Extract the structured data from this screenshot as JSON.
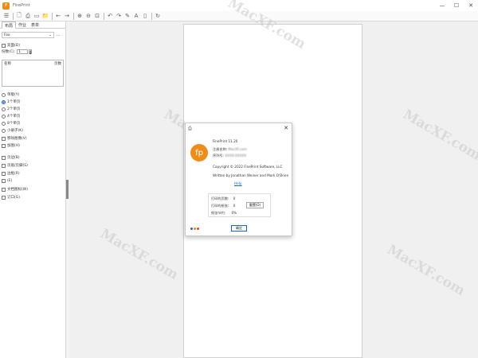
{
  "window": {
    "title": "FinePrint",
    "minimize": "—",
    "maximize": "☐",
    "close": "✕"
  },
  "toolbar": {
    "buttons": [
      "☰",
      "🗋",
      "⎙",
      "▭",
      "📁",
      "←",
      "→",
      "⊕",
      "⊖",
      "⊡",
      "↶",
      "↷",
      "✎",
      "A",
      "▯",
      "↻"
    ]
  },
  "left": {
    "tabs": [
      "布局",
      "作业",
      "表单"
    ],
    "printer": "Fax",
    "more": "...",
    "duplex": "双面(D)",
    "copies_label": "份数(C):",
    "copies_value": "1",
    "list_headers": [
      "名称",
      "页数"
    ],
    "layout_options": [
      {
        "label": "单版(Y)",
        "checked": false
      },
      {
        "label": "1个单页",
        "checked": true
      },
      {
        "label": "2个单页",
        "checked": false
      },
      {
        "label": "4个单页",
        "checked": false
      },
      {
        "label": "8个单页",
        "checked": false
      },
      {
        "label": "小册子(K)",
        "checked": false
      }
    ],
    "check_options": [
      "移除图像(V)",
      "加图(H)",
      "页边(B)",
      "页眉/页脚(S)",
      "边框(R)",
      "(E)",
      "文档图标(W)",
      "订口(G)"
    ]
  },
  "dialog": {
    "icon": "⎙",
    "close": "✕",
    "logo": "fp",
    "version": "FinePrint 11.20",
    "reg_name_label": "注册名称:",
    "reg_name_value": "MacXF.com",
    "serial_label": "序列号:",
    "serial_value": "XXXX-XXXXX",
    "copyright": "Copyright © 2022 FinePrint Software, LLC",
    "written_by": "Written by Jonathan Weiner and Mark O'Brien",
    "link": "Help",
    "printed_pages_label": "打印的页数:",
    "printed_pages_value": "0",
    "saved_pages_label": "打印的纸张:",
    "saved_pages_value": "0",
    "savings_label": "纸张节约:",
    "savings_value": "0%",
    "reset": "重置(O)",
    "ok": "确定"
  },
  "watermark": "MacXF.com",
  "colors": {
    "brand": "#f08c1a",
    "accent": "#1a66c2"
  }
}
